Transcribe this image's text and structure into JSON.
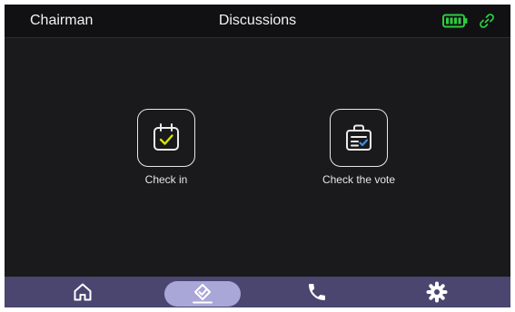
{
  "header": {
    "role": "Chairman",
    "title": "Discussions"
  },
  "status": {
    "battery_icon": "battery-full-icon",
    "connection_icon": "link-icon",
    "accent_color": "#2ecc40"
  },
  "tiles": [
    {
      "label": "Check in",
      "icon": "calendar-check-icon",
      "accent_color": "#d6e600"
    },
    {
      "label": "Check the vote",
      "icon": "briefcase-list-icon",
      "accent_color": "#3a8fe8"
    }
  ],
  "nav": {
    "items": [
      {
        "icon": "home-icon",
        "active": false
      },
      {
        "icon": "vote-icon",
        "active": true
      },
      {
        "icon": "phone-icon",
        "active": false
      },
      {
        "icon": "settings-icon",
        "active": false
      }
    ],
    "bar_color": "#4a4670",
    "active_color": "#a9a6d8"
  }
}
